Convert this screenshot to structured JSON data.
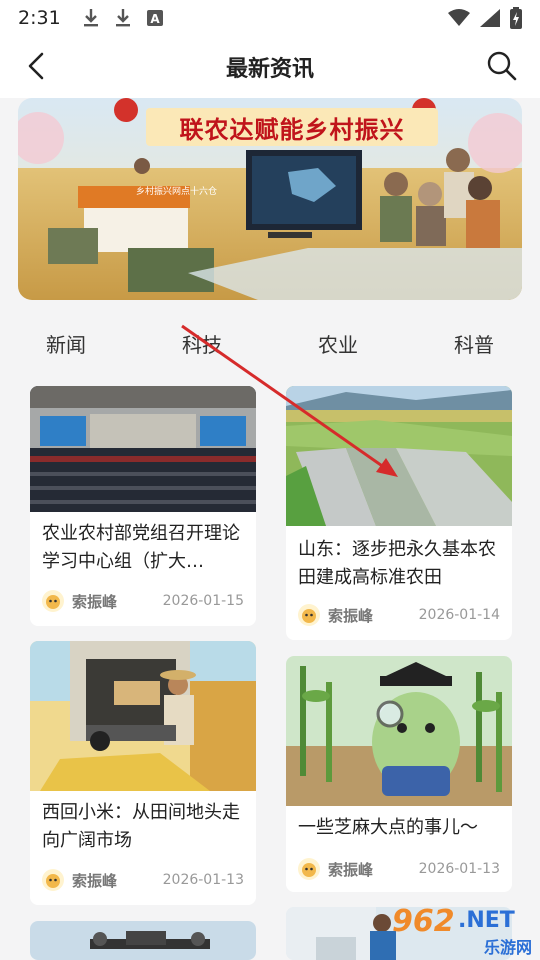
{
  "status_bar": {
    "time": "2:31",
    "icons": [
      "download-icon",
      "download-icon",
      "a-badge-icon",
      "wifi-icon",
      "signal-icon",
      "battery-charging-icon"
    ]
  },
  "nav": {
    "title": "最新资讯",
    "back_icon": "chevron-left-icon",
    "search_icon": "search-icon"
  },
  "banner": {
    "title": "联农达赋能乡村振兴",
    "sign": "乡村振兴网点十六仓"
  },
  "tabs": [
    {
      "label": "新闻"
    },
    {
      "label": "科技"
    },
    {
      "label": "农业"
    },
    {
      "label": "科普"
    }
  ],
  "articles": [
    {
      "title": "农业农村部党组召开理论学习中心组（扩大…",
      "author": "索振峰",
      "date": "2026-01-15"
    },
    {
      "title": "山东：逐步把永久基本农田建成高标准农田",
      "author": "索振峰",
      "date": "2026-01-14"
    },
    {
      "title": "西回小米：从田间地头走向广阔市场",
      "author": "索振峰",
      "date": "2026-01-13"
    },
    {
      "title": "一些芝麻大点的事儿～",
      "author": "索振峰",
      "date": "2026-01-13"
    }
  ],
  "watermark": {
    "number": "962",
    "net": ".NET",
    "cn": "乐游网"
  },
  "colors": {
    "banner_title": "#c0141b",
    "arrow": "#d62b2b"
  }
}
